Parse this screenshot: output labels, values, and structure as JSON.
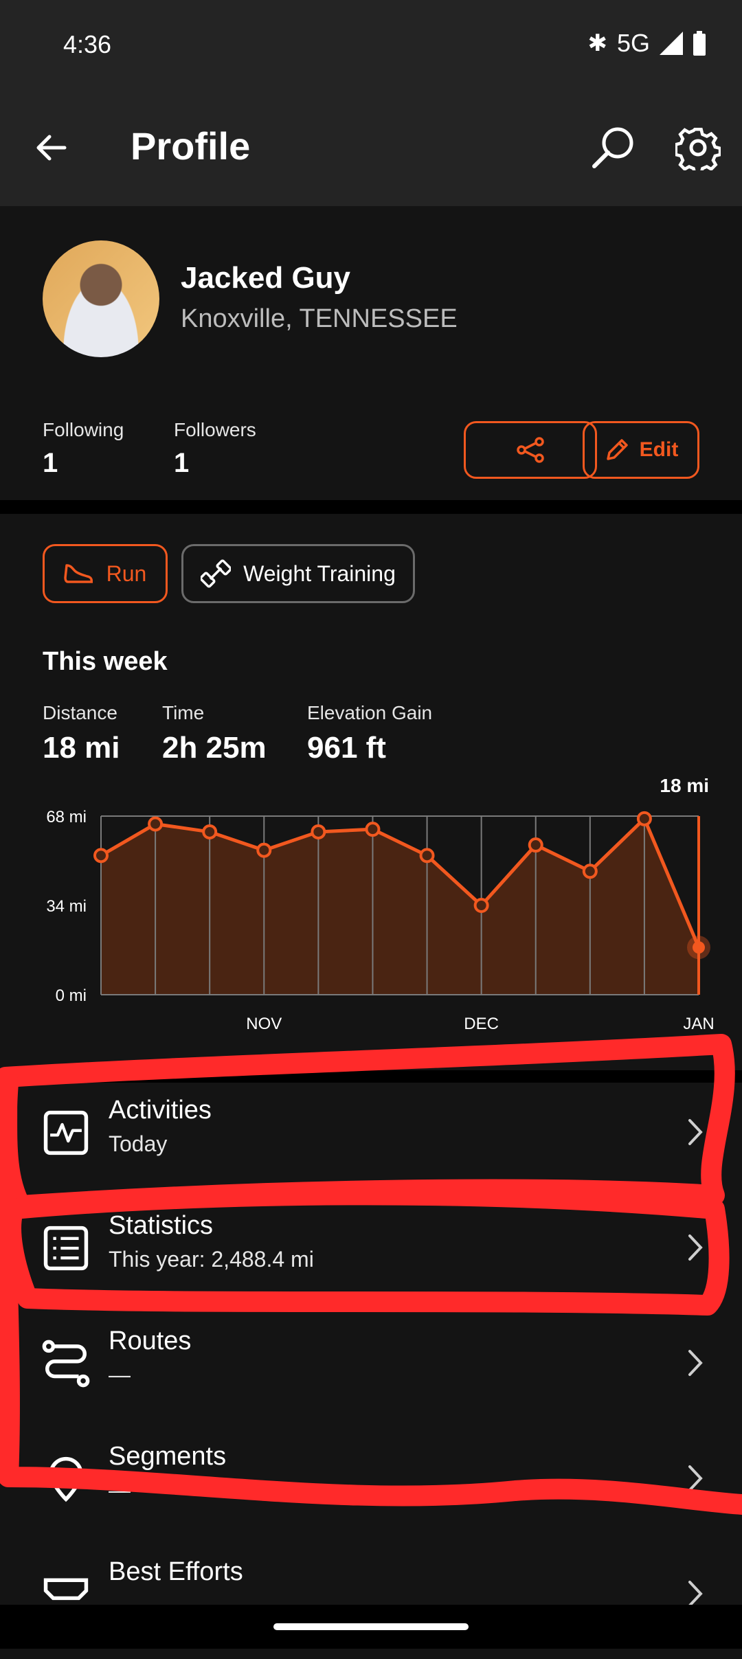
{
  "status": {
    "time": "4:36",
    "network": "5G"
  },
  "header": {
    "title": "Profile"
  },
  "profile": {
    "name": "Jacked Guy",
    "location": "Knoxville, TENNESSEE"
  },
  "social": {
    "following_label": "Following",
    "following_count": "1",
    "followers_label": "Followers",
    "followers_count": "1",
    "edit_label": "Edit"
  },
  "chips": {
    "run": "Run",
    "weight": "Weight Training"
  },
  "week": {
    "title": "This week",
    "distance_label": "Distance",
    "distance_value": "18 mi",
    "time_label": "Time",
    "time_value": "2h 25m",
    "elev_label": "Elevation Gain",
    "elev_value": "961 ft"
  },
  "chart_data": {
    "type": "area",
    "current_label": "18 mi",
    "y_ticks": [
      "68 mi",
      "34 mi",
      "0 mi"
    ],
    "ylim": [
      0,
      68
    ],
    "x_labels": [
      {
        "label": "NOV",
        "index": 3
      },
      {
        "label": "DEC",
        "index": 7
      },
      {
        "label": "JAN",
        "index": 11
      }
    ],
    "values": [
      53,
      65,
      62,
      55,
      62,
      63,
      53,
      34,
      57,
      47,
      67,
      18
    ],
    "colors": {
      "line": "#f2581f",
      "fill": "#4a2412",
      "grid": "#7a7a7a"
    }
  },
  "nav": [
    {
      "title": "Activities",
      "sub": "Today",
      "icon": "activity-chart-icon"
    },
    {
      "title": "Statistics",
      "sub": "This year: 2,488.4 mi",
      "icon": "statistics-list-icon"
    },
    {
      "title": "Routes",
      "sub": "—",
      "icon": "route-icon"
    },
    {
      "title": "Segments",
      "sub": "—",
      "icon": "segment-pin-icon"
    },
    {
      "title": "Best Efforts",
      "sub": "",
      "icon": "best-efforts-icon"
    }
  ],
  "colors": {
    "accent": "#f2581f",
    "background": "#141414",
    "annotation": "#ff2a2a"
  }
}
